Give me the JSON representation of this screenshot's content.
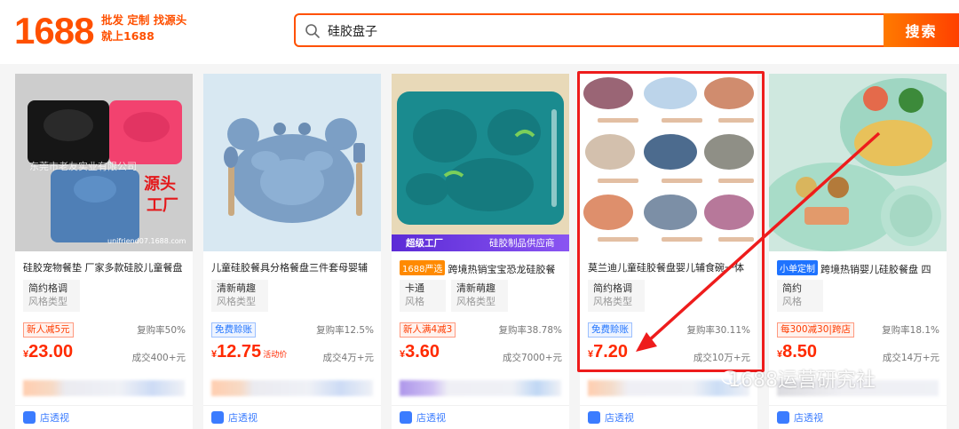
{
  "header": {
    "logo": "1688",
    "slogan_line1": "批发 定制 找源头",
    "slogan_line2": "就上1688",
    "search_value": "硅胶盘子",
    "search_button": "搜索"
  },
  "products": [
    {
      "title": "硅胶宠物餐垫 厂家多款硅胶儿童餐盘",
      "img_text_1": "东莞市老友实业有限公司",
      "img_text_2": "源头",
      "img_text_3": "工厂",
      "img_text_4": "unifriend07.1688.com",
      "attrs": [
        {
          "value": "简约格调",
          "key": "风格类型"
        }
      ],
      "promo": "新人减5元",
      "repurchase": "复购率50%",
      "currency": "¥",
      "price": "23.00",
      "deals": "成交400+元",
      "shop": "店透视"
    },
    {
      "title": "儿童硅胶餐具分格餐盘三件套母婴辅",
      "attrs": [
        {
          "value": "清新萌趣",
          "key": "风格类型"
        }
      ],
      "promo": "免费赊账",
      "repurchase": "复购率12.5%",
      "currency": "¥",
      "price": "12.75",
      "price_note": "活动价",
      "deals": "成交4万+元",
      "shop": "店透视"
    },
    {
      "badge": "1688严选",
      "title": "跨境热销宝宝恐龙硅胶餐",
      "banner_left": "超级工厂",
      "banner_right": "硅胶制品供应商",
      "attrs": [
        {
          "value": "卡通",
          "key": "风格"
        },
        {
          "value": "清新萌趣",
          "key": "风格类型"
        }
      ],
      "promo": "新人满4减3",
      "repurchase": "复购率38.78%",
      "currency": "¥",
      "price": "3.60",
      "deals": "成交7000+元",
      "shop": "店透视"
    },
    {
      "title": "莫兰迪儿童硅胶餐盘婴儿辅食碗一体",
      "attrs": [
        {
          "value": "简约格调",
          "key": "风格类型"
        }
      ],
      "promo": "免费赊账",
      "repurchase": "复购率30.11%",
      "currency": "¥",
      "price": "7.20",
      "deals": "成交10万+元",
      "shop": "店透视"
    },
    {
      "badge": "小单定制",
      "title": "跨境热销婴儿硅胶餐盘 四",
      "attrs": [
        {
          "value": "简约",
          "key": "风格"
        }
      ],
      "promo": "每300减30|跨店",
      "repurchase": "复购率18.1%",
      "currency": "¥",
      "price": "8.50",
      "deals": "成交14万+元",
      "shop": "店透视"
    }
  ],
  "watermark": "1688运营研究社",
  "colors": {
    "brand": "#ff5000",
    "price": "#ff2a00",
    "highlight": "#ee1c1c",
    "blue_promo": "#1f73ff"
  }
}
